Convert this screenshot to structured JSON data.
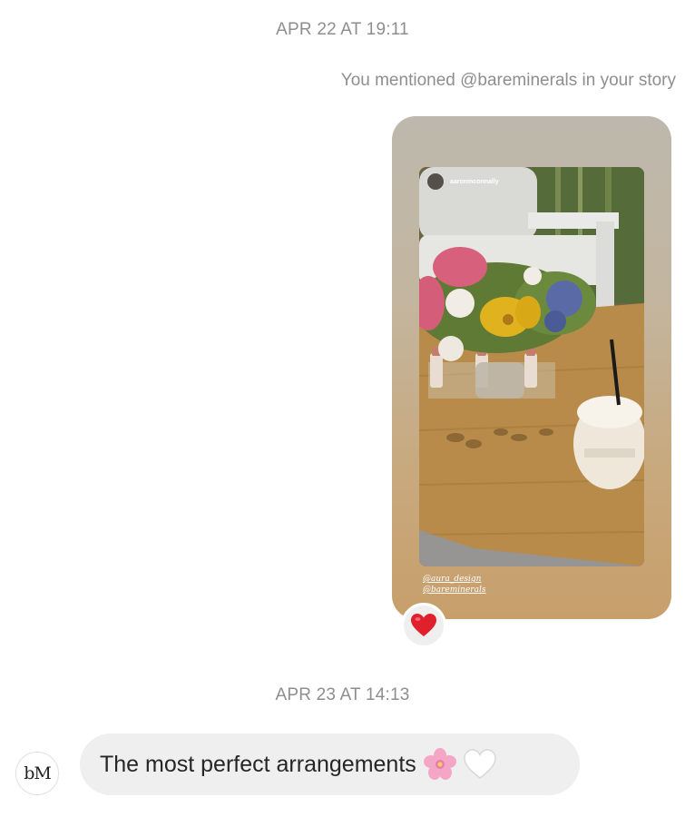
{
  "thread": {
    "timestamp_1": "APR 22 AT 19:11",
    "mention_text": "You mentioned @bareminerals in your story",
    "story": {
      "username": "aaronmconnally",
      "tags": [
        "@aura_design",
        "@bareminerals"
      ],
      "image_icon": "story-photo-flowers-table"
    },
    "reaction_icon": "red-heart-icon",
    "timestamp_2": "APR 23 AT 14:13",
    "message": {
      "sender_avatar_text": "bM",
      "text": "The most perfect arrangements",
      "emojis": [
        "cherry-blossom-icon",
        "white-heart-icon"
      ]
    }
  },
  "colors": {
    "bubble_bg": "#efefef",
    "timestamp": "#8e8e8e",
    "heart": "#e0202c"
  }
}
